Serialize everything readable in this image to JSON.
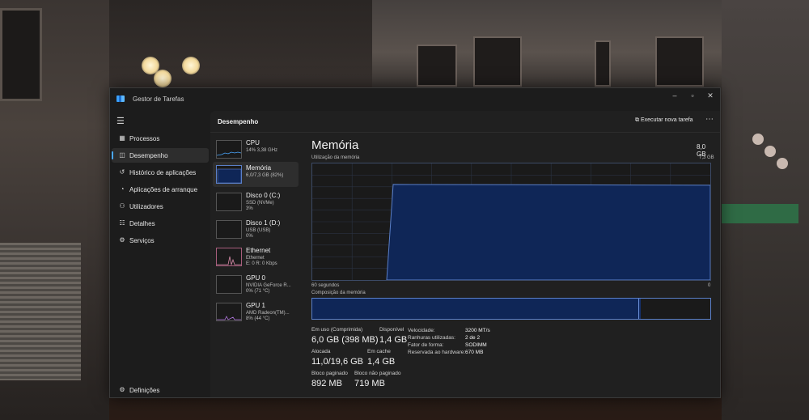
{
  "window": {
    "title": "Gestor de Tarefas"
  },
  "header": {
    "title": "Desempenho",
    "run_task": "Executar nova tarefa",
    "more": "⋯"
  },
  "sidebar": {
    "items": [
      {
        "label": "Processos",
        "icon": "processes-icon"
      },
      {
        "label": "Desempenho",
        "icon": "performance-icon",
        "active": true
      },
      {
        "label": "Histórico de aplicações",
        "icon": "history-icon"
      },
      {
        "label": "Aplicações de arranque",
        "icon": "startup-icon"
      },
      {
        "label": "Utilizadores",
        "icon": "users-icon"
      },
      {
        "label": "Detalhes",
        "icon": "details-icon"
      },
      {
        "label": "Serviços",
        "icon": "services-icon"
      }
    ],
    "settings": "Definições"
  },
  "perf_list": [
    {
      "name": "CPU",
      "line1": "14% 3,38 GHz",
      "line2": "",
      "color": "#4aa8ff"
    },
    {
      "name": "Memória",
      "line1": "6,0/7,3 GB (82%)",
      "line2": "",
      "color": "#5a7fc8",
      "active": true
    },
    {
      "name": "Disco 0 (C:)",
      "line1": "SSD (NVMe)",
      "line2": "3%",
      "color": "#6ecf6e"
    },
    {
      "name": "Disco 1 (D:)",
      "line1": "USB (USB)",
      "line2": "0%",
      "color": "#6ecf6e"
    },
    {
      "name": "Ethernet",
      "line1": "Ethernet",
      "line2": "E: 0 R: 0 Kbps",
      "color": "#d68aa8"
    },
    {
      "name": "GPU 0",
      "line1": "NVIDIA GeForce R...",
      "line2": "0% (71 °C)",
      "color": "#b278e0"
    },
    {
      "name": "GPU 1",
      "line1": "AMD Radeon(TM)...",
      "line2": "8% (44 °C)",
      "color": "#b278e0"
    }
  ],
  "memory": {
    "title": "Memória",
    "capacity": "8,0 GB",
    "usage_label": "Utilização da memória",
    "usage_max": "7,3 GB",
    "graph_left": "60 segundos",
    "graph_right": "0",
    "composition_label": "Composição da memória",
    "usage_fraction": 0.82,
    "composition": {
      "in_use_fraction": 0.82,
      "modified_fraction": 0.005
    },
    "stats": {
      "in_use_label": "Em uso (Comprimida)",
      "in_use": "6,0 GB (398 MB)",
      "available_label": "Disponível",
      "available": "1,4 GB",
      "committed_label": "Alocada",
      "committed": "11,0/19,6 GB",
      "cached_label": "Em cache",
      "cached": "1,4 GB",
      "paged_label": "Bloco paginado",
      "paged": "892 MB",
      "nonpaged_label": "Bloco não paginado",
      "nonpaged": "719 MB"
    },
    "hw": [
      {
        "k": "Velocidade:",
        "v": "3200 MT/s"
      },
      {
        "k": "Ranhuras utilizadas:",
        "v": "2 de 2"
      },
      {
        "k": "Fator de forma:",
        "v": "SODIMM"
      },
      {
        "k": "Reservada ao hardware:",
        "v": "670 MB"
      }
    ]
  },
  "colors": {
    "accent": "#4aa8ff",
    "memory_fill": "#0f2657",
    "memory_line": "#5a7fc8"
  }
}
